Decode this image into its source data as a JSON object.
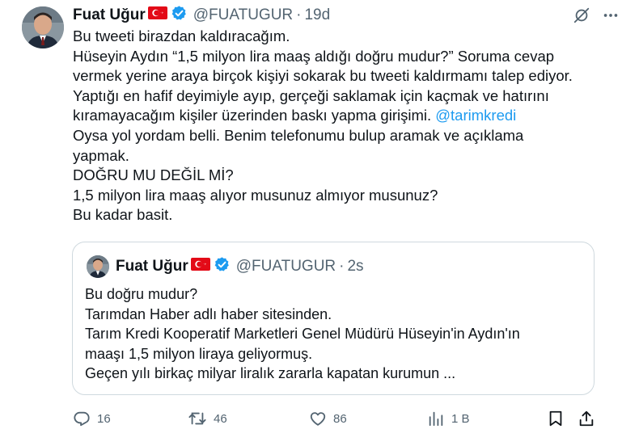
{
  "tweet": {
    "name": "Fuat Uğur",
    "handle": "@FUATUGUR",
    "separator": "·",
    "time": "19d",
    "lines": [
      "Bu tweeti birazdan kaldıracağım.",
      "Hüseyin Aydın “1,5 milyon lira maaş aldığı doğru mudur?”  Soruma cevap",
      "vermek yerine araya birçok kişiyi sokarak bu tweeti kaldırmamı talep ediyor.",
      "Yaptığı en hafif deyimiyle ayıp, gerçeği saklamak için kaçmak ve hatırını",
      "kıramayacağım kişiler üzerinden baskı yapma girişimi."
    ],
    "mention": "@tarimkredi",
    "lines_after": [
      "Oysa yol yordam belli. Benim telefonumu bulup aramak ve açıklama",
      "yapmak.",
      "DOĞRU MU DEĞİL Mİ?",
      "1,5 milyon lira maaş alıyor musunuz almıyor musunuz?",
      "Bu kadar basit."
    ]
  },
  "quote": {
    "name": "Fuat Uğur",
    "handle": "@FUATUGUR",
    "separator": "·",
    "time": "2s",
    "lines": [
      "Bu doğru mudur?",
      "Tarımdan Haber adlı haber sitesinden.",
      "Tarım Kredi Kooperatif Marketleri Genel Müdürü Hüseyin'in Aydın'ın",
      "maaşı 1,5 milyon liraya geliyormuş.",
      "Geçen yılı birkaç milyar liralık zararla kapatan kurumun ..."
    ]
  },
  "actions": {
    "replies": "16",
    "reposts": "46",
    "likes": "86",
    "views": "1 B"
  },
  "icons": {
    "verified": "verified-badge-icon",
    "flag": "turkey-flag-icon",
    "grok": "grok-icon",
    "more": "more-icon",
    "reply": "reply-icon",
    "repost": "repost-icon",
    "like": "heart-icon",
    "views": "views-icon",
    "bookmark": "bookmark-icon",
    "share": "share-icon"
  },
  "colors": {
    "text": "#0f1419",
    "secondary": "#536471",
    "link": "#1d9bf0",
    "verified": "#1d9bf0",
    "flag": "#e30a17",
    "border": "#cfd9de"
  }
}
